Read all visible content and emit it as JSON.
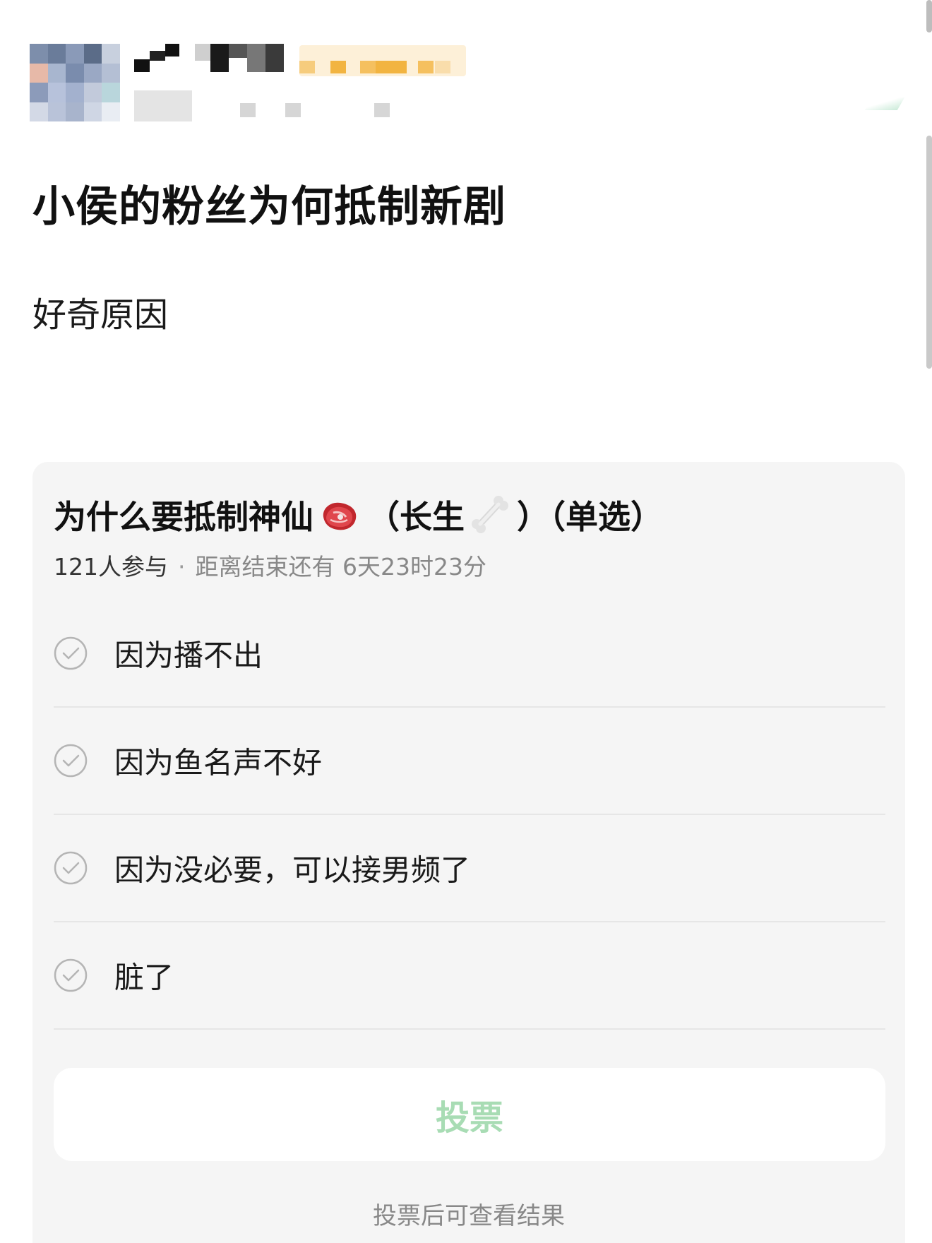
{
  "post": {
    "title": "小侯的粉丝为何抵制新剧",
    "body": "好奇原因"
  },
  "poll": {
    "question": {
      "part1": "为什么要抵制神仙",
      "part2": "（长生",
      "part3": "）（单选）",
      "emoji_1": "meat-emoji",
      "emoji_2": "bone-emoji"
    },
    "participants": "121人参与",
    "separator": "·",
    "time_remaining": "距离结束还有 6天23时23分",
    "options": [
      {
        "label": "因为播不出"
      },
      {
        "label": "因为鱼名声不好"
      },
      {
        "label": "因为没必要，可以接男频了"
      },
      {
        "label": "脏了"
      }
    ],
    "vote_button": "投票",
    "hint": "投票后可查看结果"
  },
  "colors": {
    "vote_button_text": "#a8dcb4",
    "card_background": "#f5f5f5",
    "meta_text": "#888888"
  }
}
